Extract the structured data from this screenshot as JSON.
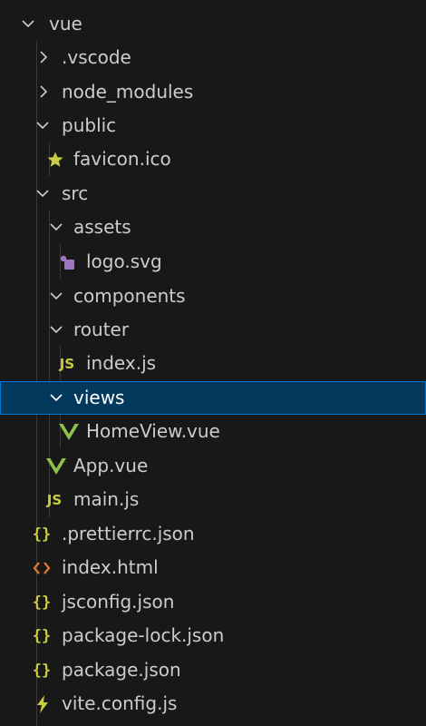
{
  "colors": {
    "background": "#181818",
    "selected_background": "#04395e",
    "selected_border": "#0078d4",
    "text": "#cccccc",
    "json_icon": "#cbcb41",
    "js_icon": "#cbcb41",
    "vue_icon": "#8dc149",
    "svg_icon": "#a074c4",
    "html_icon": "#e37933",
    "favicon_icon": "#cbcb41",
    "vite_icon": "#cbcb41"
  },
  "tree": [
    {
      "label": "vue",
      "type": "folder",
      "expanded": true,
      "depth": 0,
      "icon": "chevron-down-icon"
    },
    {
      "label": ".vscode",
      "type": "folder",
      "expanded": false,
      "depth": 1,
      "icon": "chevron-right-icon"
    },
    {
      "label": "node_modules",
      "type": "folder",
      "expanded": false,
      "depth": 1,
      "icon": "chevron-right-icon"
    },
    {
      "label": "public",
      "type": "folder",
      "expanded": true,
      "depth": 1,
      "icon": "chevron-down-icon"
    },
    {
      "label": "favicon.ico",
      "type": "file",
      "depth": 2,
      "icon": "star-icon"
    },
    {
      "label": "src",
      "type": "folder",
      "expanded": true,
      "depth": 1,
      "icon": "chevron-down-icon"
    },
    {
      "label": "assets",
      "type": "folder",
      "expanded": true,
      "depth": 2,
      "icon": "chevron-down-icon"
    },
    {
      "label": "logo.svg",
      "type": "file",
      "depth": 3,
      "icon": "svg-file-icon"
    },
    {
      "label": "components",
      "type": "folder",
      "expanded": true,
      "depth": 2,
      "icon": "chevron-down-icon"
    },
    {
      "label": "router",
      "type": "folder",
      "expanded": true,
      "depth": 2,
      "icon": "chevron-down-icon"
    },
    {
      "label": "index.js",
      "type": "file",
      "depth": 3,
      "icon": "js-file-icon",
      "icon_text": "JS"
    },
    {
      "label": "views",
      "type": "folder",
      "expanded": true,
      "depth": 2,
      "icon": "chevron-down-icon",
      "selected": true
    },
    {
      "label": "HomeView.vue",
      "type": "file",
      "depth": 3,
      "icon": "vue-file-icon"
    },
    {
      "label": "App.vue",
      "type": "file",
      "depth": 2,
      "icon": "vue-file-icon"
    },
    {
      "label": "main.js",
      "type": "file",
      "depth": 2,
      "icon": "js-file-icon",
      "icon_text": "JS"
    },
    {
      "label": ".prettierrc.json",
      "type": "file",
      "depth": 1,
      "icon": "json-file-icon",
      "icon_text": "{}"
    },
    {
      "label": "index.html",
      "type": "file",
      "depth": 1,
      "icon": "html-file-icon"
    },
    {
      "label": "jsconfig.json",
      "type": "file",
      "depth": 1,
      "icon": "json-file-icon",
      "icon_text": "{}"
    },
    {
      "label": "package-lock.json",
      "type": "file",
      "depth": 1,
      "icon": "json-file-icon",
      "icon_text": "{}"
    },
    {
      "label": "package.json",
      "type": "file",
      "depth": 1,
      "icon": "json-file-icon",
      "icon_text": "{}"
    },
    {
      "label": "vite.config.js",
      "type": "file",
      "depth": 1,
      "icon": "lightning-icon"
    }
  ]
}
